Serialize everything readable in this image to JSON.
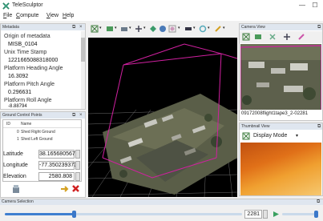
{
  "window": {
    "title": "TeleSculptor",
    "minimize": "—",
    "maximize": "☐"
  },
  "menu": [
    {
      "underline": "F",
      "rest": "ile"
    },
    {
      "underline": "C",
      "rest": "ompute"
    },
    {
      "underline": "V",
      "rest": "iew"
    },
    {
      "underline": "H",
      "rest": "elp"
    }
  ],
  "metadata": {
    "header": "Metadata",
    "rows": [
      {
        "label": "Origin of metadata",
        "value": "MISB_0104"
      },
      {
        "label": "Unix Time Stamp",
        "value": "1221665088318000"
      },
      {
        "label": "Platform Heading Angle",
        "value": "16.3092"
      },
      {
        "label": "Platform Pitch Angle",
        "value": "0.296631"
      },
      {
        "label": "Platform Roll Angle",
        "value": "-8.88794"
      }
    ]
  },
  "gcp": {
    "header": "Ground Control Points",
    "columns": [
      "ID",
      "Name"
    ],
    "rows": [
      {
        "id": "0",
        "name": "Shed Right Ground"
      },
      {
        "id": "1",
        "name": "Shed Left Ground"
      }
    ],
    "latitude_label": "Latitude",
    "latitude_value": "38.165680567",
    "longitude_label": "Longitude",
    "longitude_value": "-77.350239373",
    "elevation_label": "Elevation",
    "elevation_value": "2580.808"
  },
  "camera_view": {
    "header": "Camera View",
    "frame_caption": "09172008flight1tape3_2-02281"
  },
  "thumbnail": {
    "header": "Thumbnail View",
    "display_mode_label": "Display Mode"
  },
  "camera_selection": {
    "header": "Camera Selection",
    "frame_value": "2281",
    "progress_fraction": 0.29
  },
  "colors": {
    "accent": "#3b78c9",
    "frustum": "#d020a0",
    "grid": "#ffffff",
    "dock_header": "#dfe6ef"
  }
}
